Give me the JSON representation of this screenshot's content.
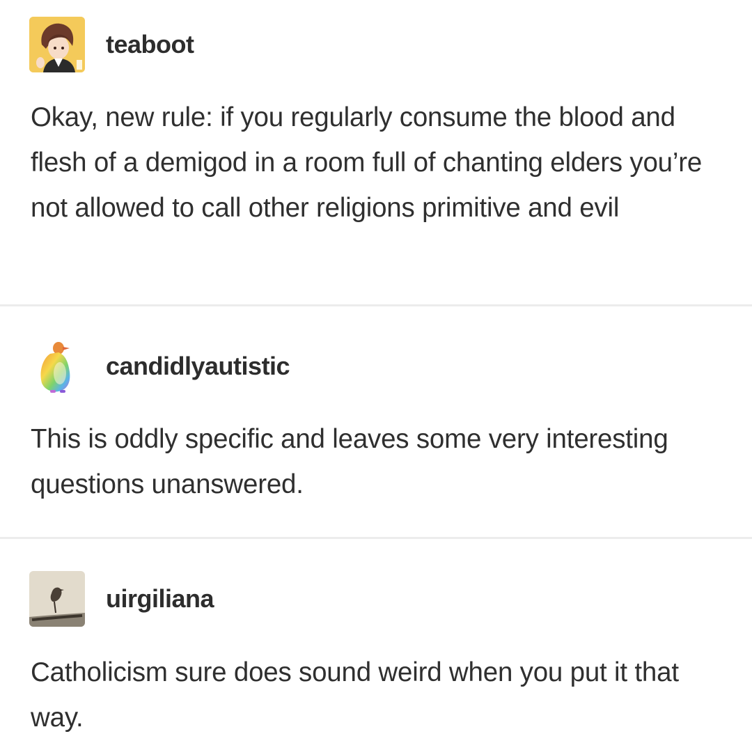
{
  "thread": [
    {
      "username": "teaboot",
      "avatar_icon": "anime-character-avatar-icon",
      "text": "Okay, new rule: if you regularly consume the blood and flesh of a demigod in a room full of chanting elders you’re not allowed to call other religions primitive and evil"
    },
    {
      "username": "candidlyautistic",
      "avatar_icon": "rainbow-penguin-avatar-icon",
      "text": "This is oddly specific and leaves some very interesting questions unanswered."
    },
    {
      "username": "uirgiliana",
      "avatar_icon": "bird-avatar-icon",
      "text": "Catholicism sure does sound weird when you put it that way."
    }
  ],
  "colors": {
    "background": "#ffffff",
    "text": "#2f2f2f",
    "divider": "#ececec"
  }
}
